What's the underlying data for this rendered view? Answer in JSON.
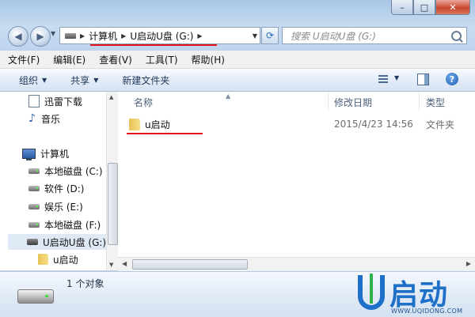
{
  "window": {
    "caption_buttons": {
      "minimize": "–",
      "maximize": "□",
      "close": "✕"
    }
  },
  "address_bar": {
    "crumbs": [
      "计算机",
      "U启动U盘 (G:)"
    ]
  },
  "search": {
    "placeholder": "搜索 U启动U盘 (G:)"
  },
  "menu": [
    "文件(F)",
    "编辑(E)",
    "查看(V)",
    "工具(T)",
    "帮助(H)"
  ],
  "command_bar": {
    "organize": "组织",
    "share": "共享",
    "new_folder": "新建文件夹"
  },
  "nav_pane": {
    "items": [
      {
        "label": "迅雷下载",
        "icon": "document-icon"
      },
      {
        "label": "音乐",
        "icon": "music-icon"
      },
      {
        "label": "计算机",
        "icon": "computer-icon"
      },
      {
        "label": "本地磁盘 (C:)",
        "icon": "hard-disk-icon"
      },
      {
        "label": "软件 (D:)",
        "icon": "hard-disk-icon"
      },
      {
        "label": "娱乐 (E:)",
        "icon": "hard-disk-icon"
      },
      {
        "label": "本地磁盘 (F:)",
        "icon": "hard-disk-icon"
      },
      {
        "label": "U启动U盘 (G:)",
        "icon": "usb-drive-icon",
        "selected": true
      },
      {
        "label": "u启动",
        "icon": "folder-icon"
      }
    ]
  },
  "columns": {
    "name": "名称",
    "date": "修改日期",
    "type": "类型"
  },
  "files": [
    {
      "name": "u启动",
      "date": "2015/4/23 14:56",
      "type": "文件夹"
    }
  ],
  "details": {
    "count": "1 个对象"
  },
  "brand": {
    "logo_letter": "U",
    "word": "启动",
    "url": "WWW.UQIDONG.COM"
  },
  "colors": {
    "accent": "#1e6fc8",
    "annotation": "#e0141b",
    "selection": "#dfe9f5"
  }
}
